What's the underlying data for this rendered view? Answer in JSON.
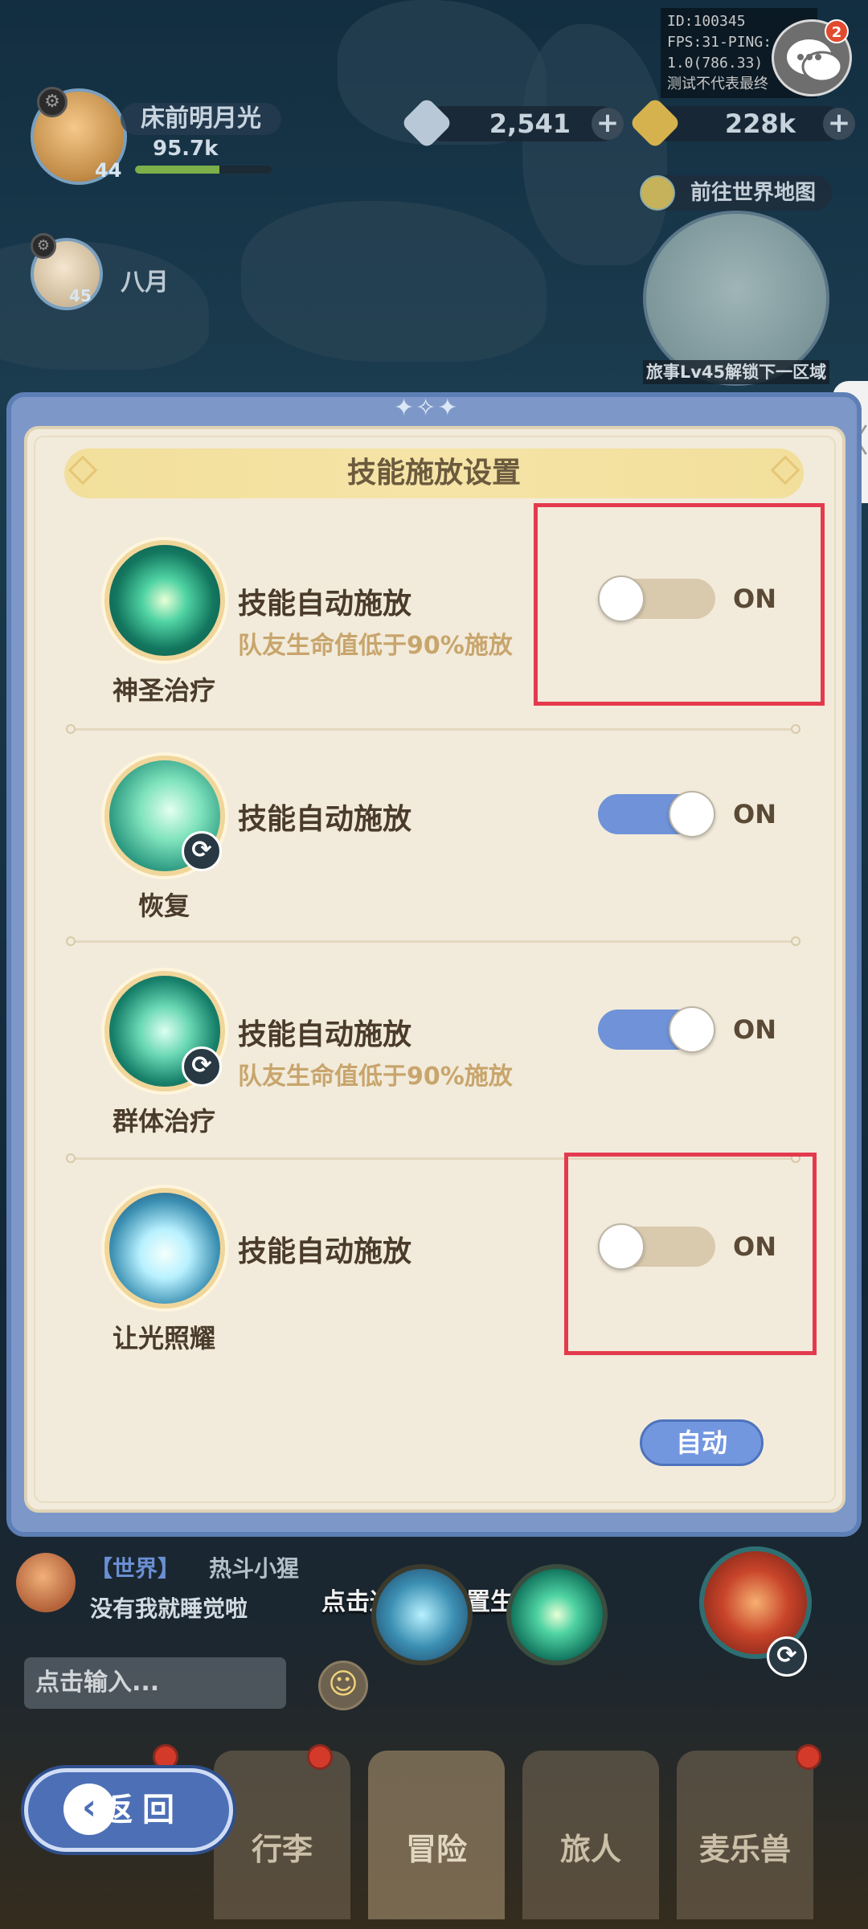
{
  "hud": {
    "player_name": "床前明月光",
    "player_level": "44",
    "player_power": "95.7k",
    "xp_fraction": 0.62,
    "companion_name": "八月",
    "companion_level": "45",
    "gems": "2,541",
    "gold": "228k",
    "debug_lines": [
      "ID:100345",
      "FPS:31-PING:",
      "1.0(786.33) 1.",
      "测试不代表最终"
    ],
    "chat_badge": "2",
    "world_map_label": "前往世界地图",
    "unlock_hint": "旅事Lv45解锁下一区域"
  },
  "modal": {
    "title": "技能施放设置",
    "rows": [
      {
        "skill_name": "神圣治疗",
        "label": "技能自动施放",
        "sub": "队友生命值低于90%施放",
        "toggle_text": "ON",
        "enabled": false
      },
      {
        "skill_name": "恢复",
        "label": "技能自动施放",
        "sub": "",
        "toggle_text": "ON",
        "enabled": true
      },
      {
        "skill_name": "群体治疗",
        "label": "技能自动施放",
        "sub": "队友生命值低于90%施放",
        "toggle_text": "ON",
        "enabled": true
      },
      {
        "skill_name": "让光照耀",
        "label": "技能自动施放",
        "sub": "",
        "toggle_text": "ON",
        "enabled": false
      }
    ],
    "auto_button": "自动"
  },
  "chat": {
    "channel": "【世界】",
    "user": "热斗小猩",
    "message": "没有我就睡觉啦",
    "input_placeholder": "点击输入...",
    "hint": "点击返回后设置生效"
  },
  "nav": {
    "back_label": "返回",
    "tabs": [
      "行李",
      "冒险",
      "旅人",
      "麦乐兽"
    ]
  },
  "colors": {
    "highlight": "#e43a4e",
    "toggle_on": "#6f92d8",
    "toggle_off": "#d9c9ad",
    "accent_blue": "#7397df"
  }
}
